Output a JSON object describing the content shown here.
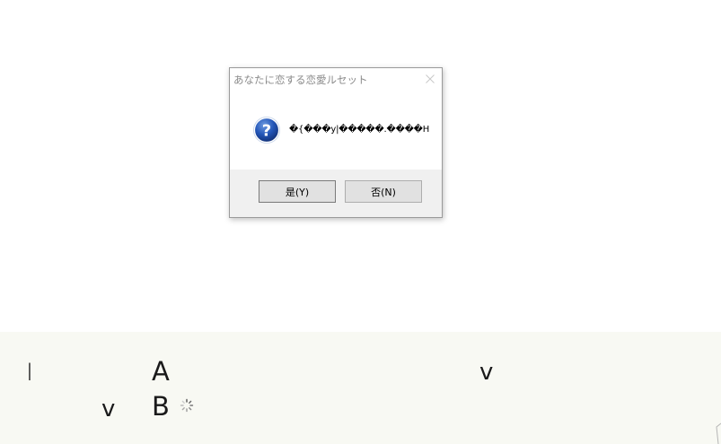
{
  "dialog": {
    "title": "あなたに恋する恋愛ルセット",
    "message": "�{���y|�����.����H",
    "yes_label": "是(Y)",
    "no_label": "否(N)",
    "icon": "question-icon",
    "close_icon": "close-icon"
  },
  "background": {
    "glyphs": {
      "i": "I",
      "a": "A",
      "v1": "v",
      "v2": "v",
      "b": "B"
    },
    "spinner_icon": "loading-spinner-icon"
  },
  "colors": {
    "bottom_panel": "#f8f9f3",
    "dialog_button_area": "#f0f0f0",
    "title_text": "#8a8a8a",
    "button_face": "#e1e1e1",
    "question_icon_blue": "#1f4fa8"
  }
}
